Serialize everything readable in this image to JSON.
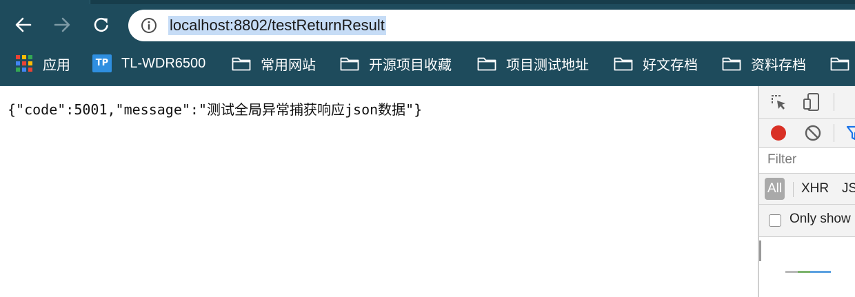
{
  "browser": {
    "address_bar": {
      "url": "localhost:8802/testReturnResult"
    },
    "bookmarks": [
      {
        "label": "应用",
        "icon": "apps-grid-icon"
      },
      {
        "label": "TL-WDR6500",
        "icon": "tp-link-icon",
        "icon_text": "TP"
      },
      {
        "label": "常用网站",
        "icon": "folder-icon"
      },
      {
        "label": "开源项目收藏",
        "icon": "folder-icon"
      },
      {
        "label": "项目测试地址",
        "icon": "folder-icon"
      },
      {
        "label": "好文存档",
        "icon": "folder-icon"
      },
      {
        "label": "资料存档",
        "icon": "folder-icon"
      }
    ],
    "colors": {
      "chrome": "#1e4b5c",
      "url_selection": "#c6dcf6",
      "tp_blue": "#2f8fe0"
    }
  },
  "page": {
    "content": "{\"code\":5001,\"message\":\"测试全局异常捕获响应json数据\"}"
  },
  "devtools": {
    "filter_placeholder": "Filter",
    "types": {
      "all": "All",
      "xhr": "XHR",
      "js": "JS"
    },
    "only_show_label": "Only show",
    "colors": {
      "record": "#d93025",
      "filter_blue": "#1a73e8"
    }
  }
}
